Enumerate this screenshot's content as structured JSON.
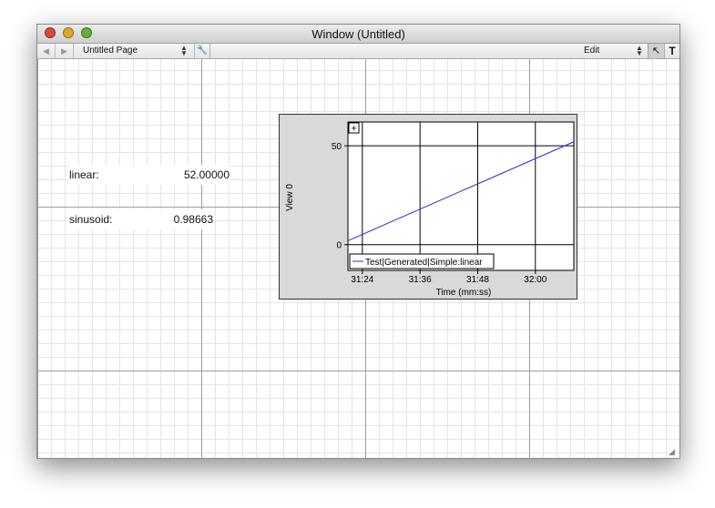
{
  "window": {
    "title": "Window (Untitled)"
  },
  "toolbar": {
    "page_select": "Untitled Page",
    "edit_select": "Edit",
    "text_tool": "T"
  },
  "readouts": [
    {
      "label": "linear:",
      "value": "52.00000"
    },
    {
      "label": "sinusoid:",
      "value": "0.98663"
    }
  ],
  "colors": {
    "close": "#e0443e",
    "minimize": "#e4a62a",
    "maximize": "#5fb336",
    "series": "#2a2ad4"
  },
  "chart_data": {
    "type": "line",
    "ylabel": "View 0",
    "xlabel": "Time (mm:ss)",
    "x_ticks": [
      "31:24",
      "31:36",
      "31:48",
      "32:00"
    ],
    "x_tick_seconds": [
      1884,
      1896,
      1908,
      1920
    ],
    "xlim_seconds": [
      1881,
      1928
    ],
    "y_ticks": [
      0,
      50
    ],
    "ylim": [
      -13,
      62
    ],
    "grid": true,
    "legend_position": "bottom-left",
    "zoom_button": "+",
    "series": [
      {
        "name": "Test|Generated|Simple:linear",
        "x_seconds": [
          1881,
          1928
        ],
        "y": [
          2,
          52
        ]
      }
    ]
  }
}
